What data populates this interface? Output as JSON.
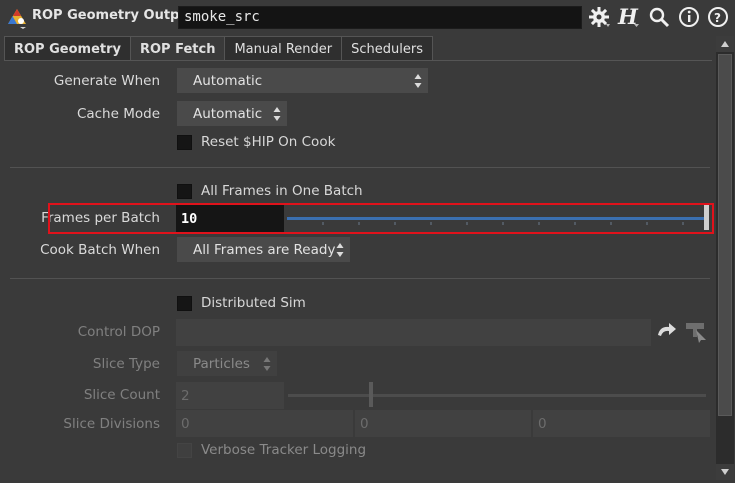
{
  "header": {
    "node_type": "ROP Geometry Output",
    "node_name": "smoke_src",
    "buttons": [
      "gear-icon",
      "houdini-help-icon",
      "search-icon",
      "info-icon",
      "help-icon"
    ]
  },
  "tabs": [
    {
      "label": "ROP Geometry",
      "active": false
    },
    {
      "label": "ROP Fetch",
      "active": true
    },
    {
      "label": "Manual Render",
      "active": false
    },
    {
      "label": "Schedulers",
      "active": false
    }
  ],
  "params": {
    "generate_when": {
      "label": "Generate When",
      "value": "Automatic"
    },
    "cache_mode": {
      "label": "Cache Mode",
      "value": "Automatic"
    },
    "reset_hip": {
      "label": "Reset $HIP On Cook",
      "checked": false
    },
    "all_frames_one_batch": {
      "label": "All Frames in One Batch",
      "checked": false
    },
    "frames_per_batch": {
      "label": "Frames per Batch",
      "value": "10"
    },
    "cook_batch_when": {
      "label": "Cook Batch When",
      "value": "All Frames are Ready"
    },
    "distributed_sim": {
      "label": "Distributed Sim",
      "checked": false
    },
    "control_dop": {
      "label": "Control DOP",
      "value": ""
    },
    "slice_type": {
      "label": "Slice Type",
      "value": "Particles"
    },
    "slice_count": {
      "label": "Slice Count",
      "value": "2"
    },
    "slice_divisions": {
      "label": "Slice Divisions",
      "values": [
        "0",
        "0",
        "0"
      ]
    },
    "verbose_tracker": {
      "label": "Verbose Tracker Logging",
      "checked": false
    }
  },
  "colors": {
    "highlight": "#e0121b",
    "slider_blue": "#3a6fb0"
  }
}
